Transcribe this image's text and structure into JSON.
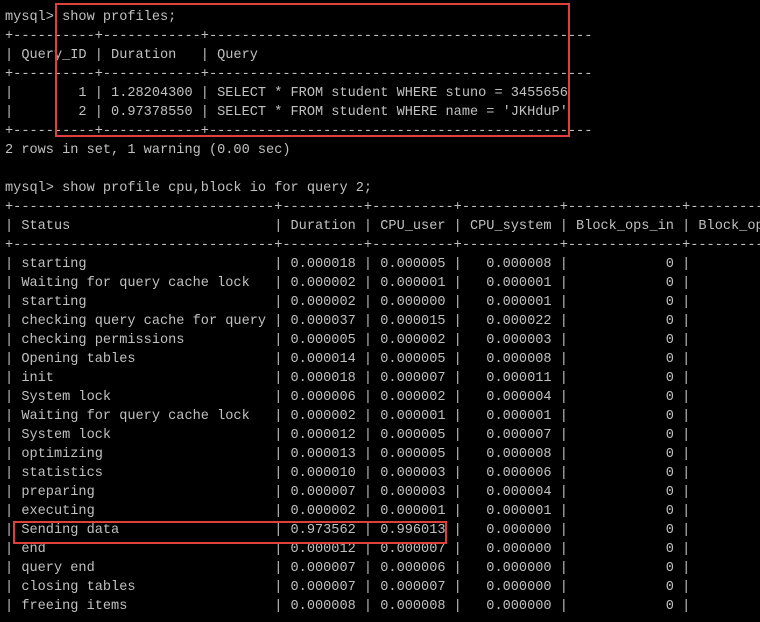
{
  "colors": {
    "background": "#000000",
    "text": "#c0c0c0",
    "highlight_box": "#e0403a"
  },
  "lines": [
    "mysql> show profiles;",
    "+----------+------------+-----------------------------------------------",
    "| Query_ID | Duration   | Query",
    "+----------+------------+-----------------------------------------------",
    "|        1 | 1.28204300 | SELECT * FROM student WHERE stuno = 3455656",
    "|        2 | 0.97378550 | SELECT * FROM student WHERE name = 'JKHduP'",
    "+----------+------------+-----------------------------------------------",
    "2 rows in set, 1 warning (0.00 sec)",
    "",
    "mysql> show profile cpu,block io for query 2;",
    "+--------------------------------+----------+----------+------------+--------------+-----------",
    "| Status                         | Duration | CPU_user | CPU_system | Block_ops_in | Block_ops_",
    "+--------------------------------+----------+----------+------------+--------------+-----------",
    "| starting                       | 0.000018 | 0.000005 |   0.000008 |            0 |",
    "| Waiting for query cache lock   | 0.000002 | 0.000001 |   0.000001 |            0 |",
    "| starting                       | 0.000002 | 0.000000 |   0.000001 |            0 |",
    "| checking query cache for query | 0.000037 | 0.000015 |   0.000022 |            0 |",
    "| checking permissions           | 0.000005 | 0.000002 |   0.000003 |            0 |",
    "| Opening tables                 | 0.000014 | 0.000005 |   0.000008 |            0 |",
    "| init                           | 0.000018 | 0.000007 |   0.000011 |            0 |",
    "| System lock                    | 0.000006 | 0.000002 |   0.000004 |            0 |",
    "| Waiting for query cache lock   | 0.000002 | 0.000001 |   0.000001 |            0 |",
    "| System lock                    | 0.000012 | 0.000005 |   0.000007 |            0 |",
    "| optimizing                     | 0.000013 | 0.000005 |   0.000008 |            0 |",
    "| statistics                     | 0.000010 | 0.000003 |   0.000006 |            0 |",
    "| preparing                      | 0.000007 | 0.000003 |   0.000004 |            0 |",
    "| executing                      | 0.000002 | 0.000001 |   0.000001 |            0 |",
    "| Sending data                   | 0.973562 | 0.996013 |   0.000000 |            0 |",
    "| end                            | 0.000012 | 0.000007 |   0.000000 |            0 |",
    "| query end                      | 0.000007 | 0.000006 |   0.000000 |            0 |",
    "| closing tables                 | 0.000007 | 0.000007 |   0.000000 |            0 |",
    "| freeing items                  | 0.000008 | 0.000008 |   0.000000 |            0 |"
  ]
}
